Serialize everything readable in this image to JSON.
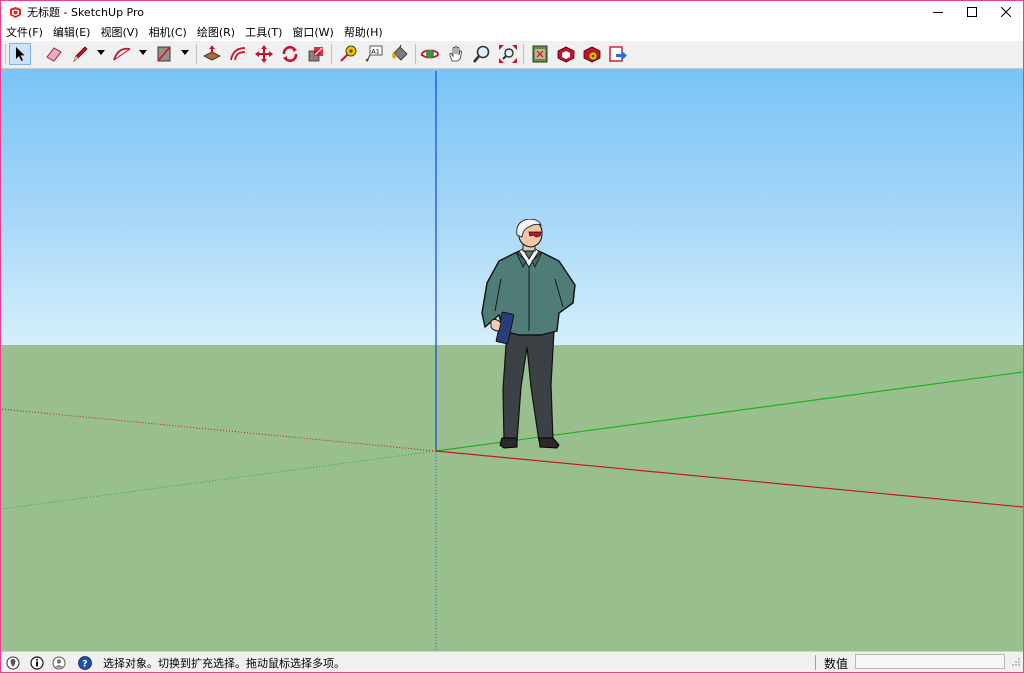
{
  "window": {
    "title": "无标题 - SketchUp Pro",
    "controls": [
      "minimize",
      "maximize",
      "close"
    ]
  },
  "menu": [
    "文件(F)",
    "编辑(E)",
    "视图(V)",
    "相机(C)",
    "绘图(R)",
    "工具(T)",
    "窗口(W)",
    "帮助(H)"
  ],
  "toolbar": {
    "tools": [
      {
        "name": "select-tool",
        "icon": "arrow-pointer-icon",
        "active": true
      },
      {
        "name": "eraser-tool",
        "icon": "eraser-icon"
      },
      {
        "name": "line-tool",
        "icon": "pencil-icon"
      },
      {
        "name": "arc-tool",
        "icon": "arc-icon"
      },
      {
        "name": "rectangle-tool",
        "icon": "rectangle-icon"
      },
      {
        "name": "push-pull-tool",
        "icon": "push-pull-icon"
      },
      {
        "name": "offset-tool",
        "icon": "offset-icon"
      },
      {
        "name": "move-tool",
        "icon": "move-icon"
      },
      {
        "name": "rotate-tool",
        "icon": "rotate-icon"
      },
      {
        "name": "scale-tool",
        "icon": "scale-icon"
      },
      {
        "name": "tape-measure-tool",
        "icon": "tape-measure-icon"
      },
      {
        "name": "text-tool",
        "icon": "text-icon"
      },
      {
        "name": "paint-bucket-tool",
        "icon": "paint-bucket-icon"
      },
      {
        "name": "orbit-tool",
        "icon": "orbit-icon"
      },
      {
        "name": "pan-tool",
        "icon": "hand-icon"
      },
      {
        "name": "zoom-tool",
        "icon": "magnifier-icon"
      },
      {
        "name": "zoom-extents-tool",
        "icon": "zoom-extents-icon"
      },
      {
        "name": "warehouse-tool",
        "icon": "3d-warehouse-icon"
      },
      {
        "name": "extension-warehouse-tool",
        "icon": "extension-warehouse-icon"
      },
      {
        "name": "extension-manager-tool",
        "icon": "extension-manager-icon"
      },
      {
        "name": "send-to-layout-tool",
        "icon": "send-to-layout-icon"
      }
    ],
    "text_tool_label": "A1"
  },
  "status": {
    "message": "选择对象。切换到扩充选择。拖动鼠标选择多项。",
    "measurements_label": "数值",
    "measurements_value": ""
  },
  "colors": {
    "window_border": "#e8408c",
    "sky_top": "#79c3f7",
    "sky_bottom": "#d6effb",
    "ground": "#9abf8f",
    "axis_red": "#c21b1b",
    "axis_green": "#22b022",
    "axis_blue": "#2050d0"
  }
}
